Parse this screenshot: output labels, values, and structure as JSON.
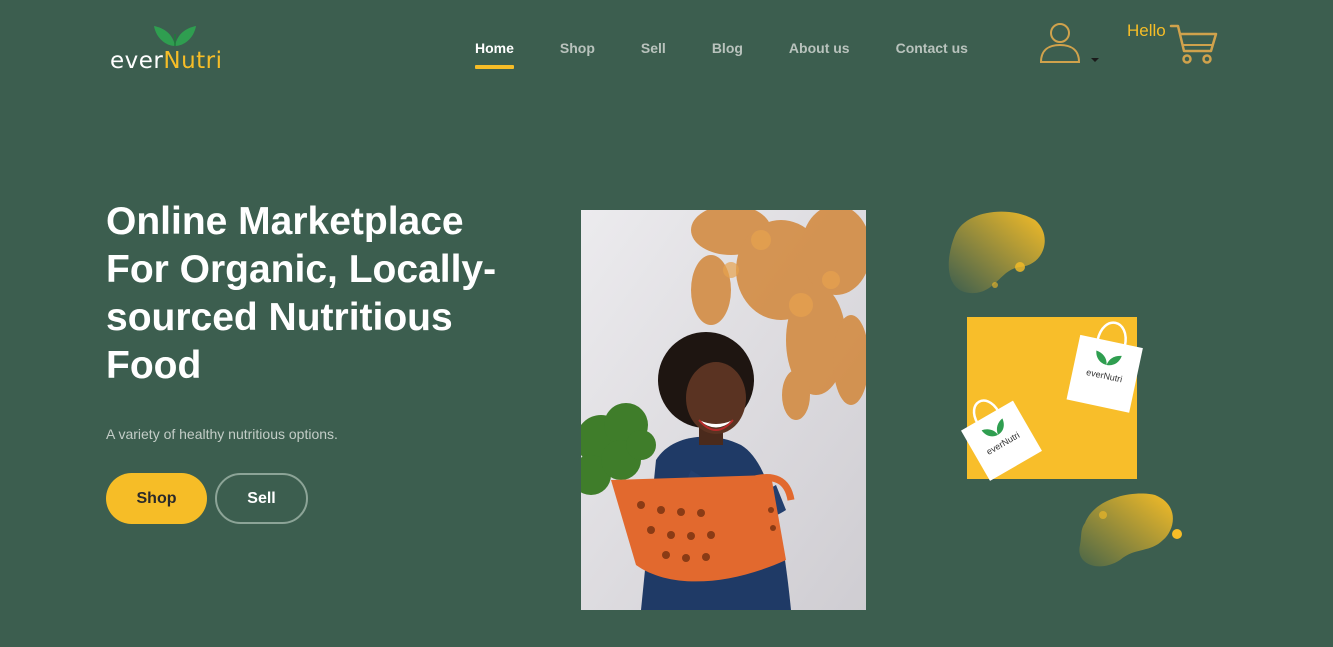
{
  "brand": {
    "prefix": "ever",
    "accent": "Nutri",
    "accent_color": "#f6bd27",
    "leaf_color": "#2f9e50"
  },
  "nav": {
    "items": [
      {
        "label": "Home",
        "active": true
      },
      {
        "label": "Shop",
        "active": false
      },
      {
        "label": "Sell",
        "active": false
      },
      {
        "label": "Blog",
        "active": false
      },
      {
        "label": "About us",
        "active": false
      },
      {
        "label": "Contact us",
        "active": false
      }
    ]
  },
  "header": {
    "user_icon": "user-icon",
    "dropdown_icon": "caret-down-icon",
    "greeting": "Hello",
    "cart_icon": "cart-icon"
  },
  "hero": {
    "title": "Online Marketplace For Organic, Locally-sourced Nutritious Food",
    "subtitle": "A variety of healthy nutritious options.",
    "primary_button": "Shop",
    "secondary_button": "Sell"
  },
  "illustration": {
    "bag_label_prefix": "ever",
    "bag_label_accent": "Nutri"
  },
  "colors": {
    "background": "#3c5e4f",
    "accent": "#f6bd27",
    "muted_text": "#c3cdc7"
  }
}
